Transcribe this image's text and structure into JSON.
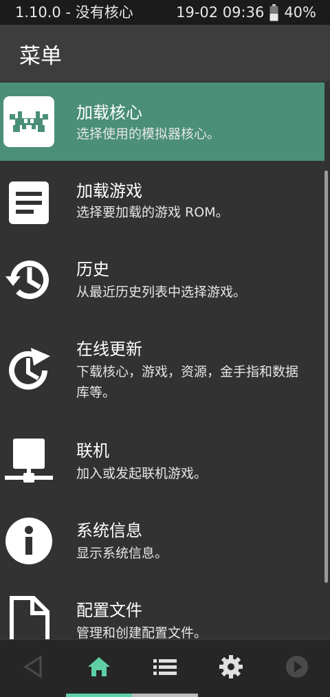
{
  "status": {
    "left_text": "1.10.0 - 没有核心",
    "datetime": "19-02 09:36",
    "battery": "40%"
  },
  "header": {
    "title": "菜单"
  },
  "menu": {
    "items": [
      {
        "title": "加载核心",
        "subtitle": "选择使用的模拟器核心。",
        "icon": "retroarch-invader-icon",
        "selected": true
      },
      {
        "title": "加载游戏",
        "subtitle": "选择要加载的游戏 ROM。",
        "icon": "document-icon"
      },
      {
        "title": "历史",
        "subtitle": "从最近历史列表中选择游戏。",
        "icon": "history-icon"
      },
      {
        "title": "在线更新",
        "subtitle": "下载核心，游戏，资源，金手指和数据库等。",
        "icon": "update-icon"
      },
      {
        "title": "联机",
        "subtitle": "加入或发起联机游戏。",
        "icon": "network-icon"
      },
      {
        "title": "系统信息",
        "subtitle": "显示系统信息。",
        "icon": "info-icon"
      },
      {
        "title": "配置文件",
        "subtitle": "管理和创建配置文件。",
        "icon": "file-icon"
      }
    ]
  },
  "bottom_nav": {
    "items": [
      "back-icon",
      "home-icon",
      "list-icon",
      "settings-icon",
      "play-icon"
    ],
    "active_index": 1
  },
  "colors": {
    "accent": "#4b8f78",
    "active_nav": "#5fd0a6"
  }
}
